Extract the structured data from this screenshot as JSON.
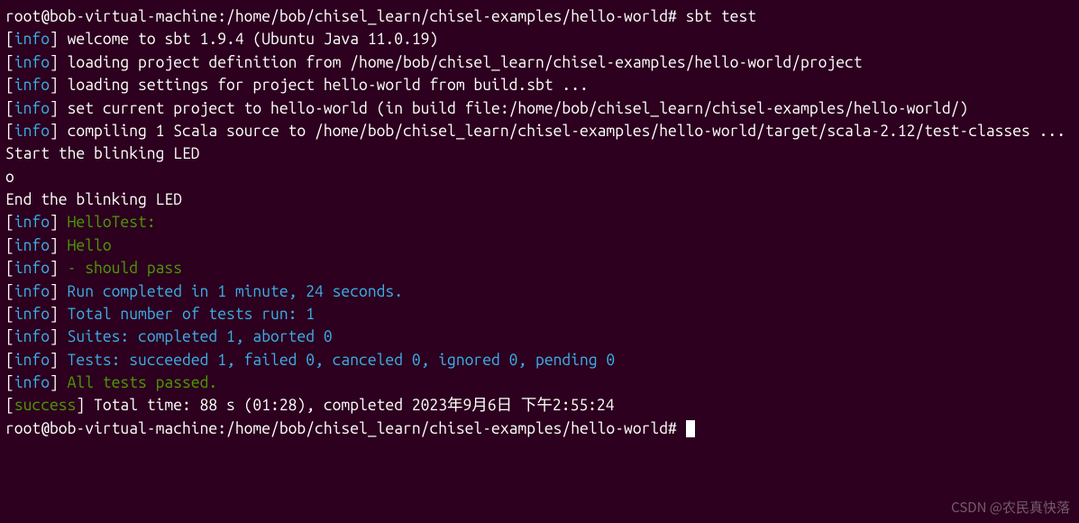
{
  "prompt1": {
    "user_host": "root@bob-virtual-machine",
    "path": "/home/bob/chisel_learn/chisel-examples/hello-world",
    "sep": "#",
    "command": "sbt test"
  },
  "lines": [
    {
      "tag": "info",
      "text": "welcome to sbt 1.9.4 (Ubuntu Java 11.0.19)"
    },
    {
      "tag": "info",
      "text": "loading project definition from /home/bob/chisel_learn/chisel-examples/hello-world/project"
    },
    {
      "tag": "info",
      "text": "loading settings for project hello-world from build.sbt ..."
    },
    {
      "tag": "info",
      "text": "set current project to hello-world (in build file:/home/bob/chisel_learn/chisel-examples/hello-world/)"
    },
    {
      "tag": "info",
      "text": "compiling 1 Scala source to /home/bob/chisel_learn/chisel-examples/hello-world/target/scala-2.12/test-classes ..."
    }
  ],
  "plain1": "Start the blinking LED",
  "plain2": "o",
  "plain3": "",
  "plain4": "End the blinking LED",
  "greenLines": [
    {
      "tag": "info",
      "text": "HelloTest:"
    },
    {
      "tag": "info",
      "text": "Hello"
    },
    {
      "tag": "info",
      "text": "- should pass"
    }
  ],
  "cyanLines": [
    {
      "tag": "info",
      "text": "Run completed in 1 minute, 24 seconds."
    },
    {
      "tag": "info",
      "text": "Total number of tests run: 1"
    },
    {
      "tag": "info",
      "text": "Suites: completed 1, aborted 0"
    },
    {
      "tag": "info",
      "text": "Tests: succeeded 1, failed 0, canceled 0, ignored 0, pending 0"
    }
  ],
  "allPassed": {
    "tag": "info",
    "text": "All tests passed."
  },
  "success": {
    "tag": "success",
    "text": "Total time: 88 s (01:28), completed 2023年9月6日 下午2:55:24"
  },
  "prompt2": {
    "user_host": "root@bob-virtual-machine",
    "path": "/home/bob/chisel_learn/chisel-examples/hello-world",
    "sep": "#"
  },
  "watermark": "CSDN @农民真快落"
}
